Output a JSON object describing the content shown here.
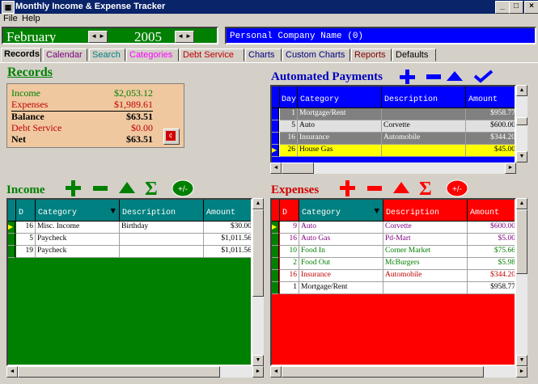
{
  "window": {
    "title": "Monthly Income & Expense Tracker",
    "minimize": "_",
    "maximize": "□",
    "close": "×"
  },
  "menu": [
    "File",
    "Help"
  ],
  "period": {
    "month": "February",
    "year": "2005"
  },
  "company": "Personal Company Name (0)",
  "tabs": [
    {
      "label": "Records",
      "color": "#000000",
      "active": true
    },
    {
      "label": "Calendar",
      "color": "#800080"
    },
    {
      "label": "Search",
      "color": "#008080"
    },
    {
      "label": "Categories",
      "color": "#ff00ff"
    },
    {
      "label": "Debt Service",
      "color": "#c00000"
    },
    {
      "label": "Charts",
      "color": "#000080"
    },
    {
      "label": "Custom Charts",
      "color": "#000080"
    },
    {
      "label": "Reports",
      "color": "#800000"
    },
    {
      "label": "Defaults",
      "color": "#000000"
    }
  ],
  "records": {
    "title": "Records",
    "income_label": "Income",
    "income_value": "$2,053.12",
    "expenses_label": "Expenses",
    "expenses_value": "$1,989.61",
    "balance_label": "Balance",
    "balance_value": "$63.51",
    "debt_label": "Debt Service",
    "debt_value": "$0.00",
    "net_label": "Net",
    "net_value": "$63.51"
  },
  "automated": {
    "title": "Automated Payments",
    "columns": [
      "Day",
      "Category",
      "Description",
      "Amount"
    ],
    "rows": [
      {
        "day": "1",
        "category": "Mortgage/Rent",
        "description": "",
        "amount": "$958.77",
        "style": "gray"
      },
      {
        "day": "5",
        "category": "Auto",
        "description": "Corvette",
        "amount": "$600.00",
        "style": "light"
      },
      {
        "day": "16",
        "category": "Insurance",
        "description": "Automobile",
        "amount": "$344.20",
        "style": "gray"
      },
      {
        "day": "26",
        "category": "House Gas",
        "description": "",
        "amount": "$45.00",
        "style": "yellow"
      }
    ]
  },
  "income": {
    "title": "Income",
    "columns": [
      "D",
      "Category",
      "Description",
      "Amount"
    ],
    "rows": [
      {
        "day": "16",
        "category": "Misc. Income",
        "description": "Birthday",
        "amount": "$30.00"
      },
      {
        "day": "5",
        "category": "Paycheck",
        "description": "",
        "amount": "$1,011.56"
      },
      {
        "day": "19",
        "category": "Paycheck",
        "description": "",
        "amount": "$1,011.56"
      }
    ]
  },
  "expenses": {
    "title": "Expenses",
    "columns": [
      "D",
      "Category",
      "Description",
      "Amount"
    ],
    "rows": [
      {
        "day": "9",
        "category": "Auto",
        "description": "Corvette",
        "amount": "$600.00",
        "color": "#800080"
      },
      {
        "day": "16",
        "category": "Auto Gas",
        "description": "Pd-Mart",
        "amount": "$5.00",
        "color": "#800080"
      },
      {
        "day": "10",
        "category": "Food In",
        "description": "Corner Market",
        "amount": "$75.66",
        "color": "#008000"
      },
      {
        "day": "2",
        "category": "Food Out",
        "description": "McBurgers",
        "amount": "$5.98",
        "color": "#008000"
      },
      {
        "day": "16",
        "category": "Insurance",
        "description": "Automobile",
        "amount": "$344.20",
        "color": "#c00000"
      },
      {
        "day": "1",
        "category": "Mortgage/Rent",
        "description": "",
        "amount": "$958.77",
        "color": "#000000"
      }
    ]
  },
  "toolbar": {
    "plusminus": "+/-",
    "sigma": "Σ"
  },
  "colors": {
    "green": "#008000",
    "red": "#ff0000",
    "blue": "#0000ff",
    "titlebar": "#0a246a"
  }
}
